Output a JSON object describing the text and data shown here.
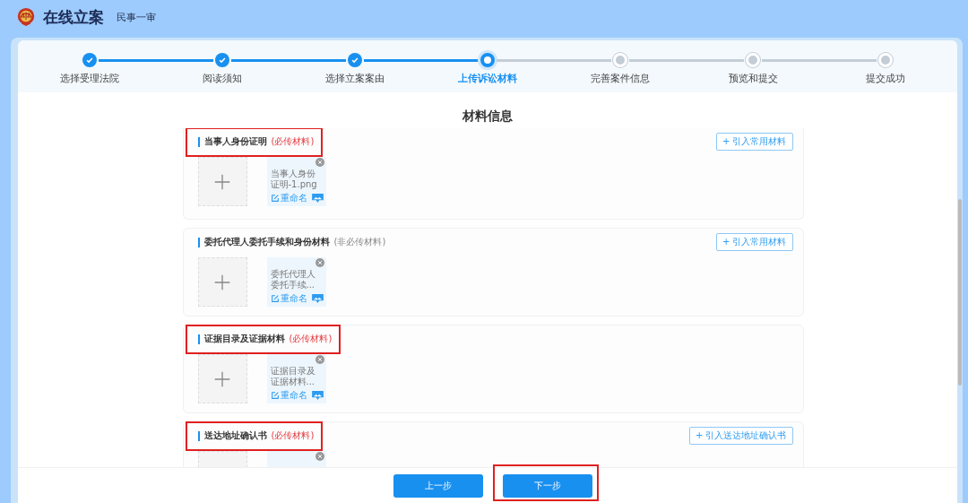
{
  "header": {
    "title": "在线立案",
    "subtitle": "民事一审"
  },
  "steps": [
    {
      "label": "选择受理法院",
      "done": true,
      "current": false
    },
    {
      "label": "阅读须知",
      "done": true,
      "current": false
    },
    {
      "label": "选择立案案由",
      "done": true,
      "current": false
    },
    {
      "label": "上传诉讼材料",
      "done": false,
      "current": true
    },
    {
      "label": "完善案件信息",
      "done": false,
      "current": false
    },
    {
      "label": "预览和提交",
      "done": false,
      "current": false
    },
    {
      "label": "提交成功",
      "done": false,
      "current": false
    }
  ],
  "heading": "材料信息",
  "sections": [
    {
      "title": "当事人身份证明",
      "note": "(必传材料)",
      "required": true,
      "highlighted": true,
      "action": "+ 引入常用材料",
      "files": [
        {
          "kind": "file",
          "name": "当事人身份证明-1.png",
          "rename": "重命名"
        }
      ]
    },
    {
      "title": "委托代理人委托手续和身份材料",
      "note": "(非必传材料)",
      "required": false,
      "highlighted": false,
      "action": "+ 引入常用材料",
      "files": [
        {
          "kind": "file",
          "name": "委托代理人委托手续...",
          "rename": "重命名"
        }
      ]
    },
    {
      "title": "证据目录及证据材料",
      "note": "(必传材料)",
      "required": true,
      "highlighted": true,
      "files": [
        {
          "kind": "file",
          "name": "证据目录及证据材料...",
          "rename": "重命名"
        }
      ]
    },
    {
      "title": "送达地址确认书",
      "note": "(必传材料)",
      "required": true,
      "highlighted": true,
      "action": "+ 引入送达地址确认书",
      "files": [
        {
          "kind": "file"
        }
      ]
    }
  ],
  "buttons": [
    {
      "label": "上一步",
      "highlighted": false
    },
    {
      "label": "下一步",
      "highlighted": true
    }
  ]
}
